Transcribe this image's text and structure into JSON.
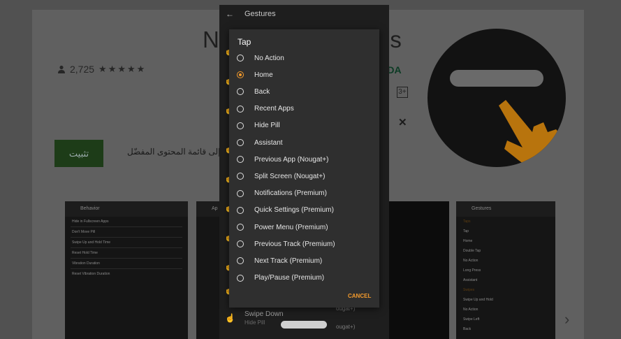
{
  "store": {
    "app_name": "N",
    "app_name_tail": "es",
    "rating_count": "2,725",
    "stars": "★★★★★",
    "developer": "XDA",
    "age_rating": "3+",
    "close_glyph": "✕",
    "install_label": "تثبيت",
    "wishlist_text": "إضافة إلى قائمة المحتوى المفضّل",
    "next_arrow": "›"
  },
  "screenshots": {
    "shot1": {
      "title": "Behavior",
      "rows": [
        "Hide in Fullscreen Apps",
        "Don't Move Pill",
        "Swipe Up and Hold Time",
        "Reset Hold Time",
        "Vibration Duration",
        "Reset Vibration Duration"
      ]
    },
    "shot2": {
      "title": "Ap"
    },
    "shot4": {
      "title": "Gestures",
      "sections": [
        "Taps",
        "Swipes"
      ],
      "rows": [
        {
          "title": "Tap",
          "sub": "Home"
        },
        {
          "title": "Double Tap",
          "sub": "No Action"
        },
        {
          "title": "Long Press",
          "sub": "Assistant"
        },
        {
          "title": "Swipe Up and Hold",
          "sub": "No Action"
        },
        {
          "title": "Swipe Left",
          "sub": "Back"
        }
      ]
    }
  },
  "gestures_screen": {
    "title": "Gestures",
    "back_glyph": "←",
    "bottom_item_title": "Swipe Down",
    "bottom_item_sub": "Hide Pill",
    "peek_1": "ougat+)",
    "peek_2": "ougat+)"
  },
  "dialog": {
    "title": "Tap",
    "selected_index": 1,
    "options": [
      "No Action",
      "Home",
      "Back",
      "Recent Apps",
      "Hide Pill",
      "Assistant",
      "Previous App (Nougat+)",
      "Split Screen (Nougat+)",
      "Notifications (Premium)",
      "Quick Settings (Premium)",
      "Power Menu (Premium)",
      "Previous Track (Premium)",
      "Next Track (Premium)",
      "Play/Pause (Premium)"
    ],
    "cancel_label": "CANCEL"
  },
  "colors": {
    "accent": "#f39a2c",
    "dialog_bg": "#2f2f2f",
    "scrim": "#515151"
  }
}
